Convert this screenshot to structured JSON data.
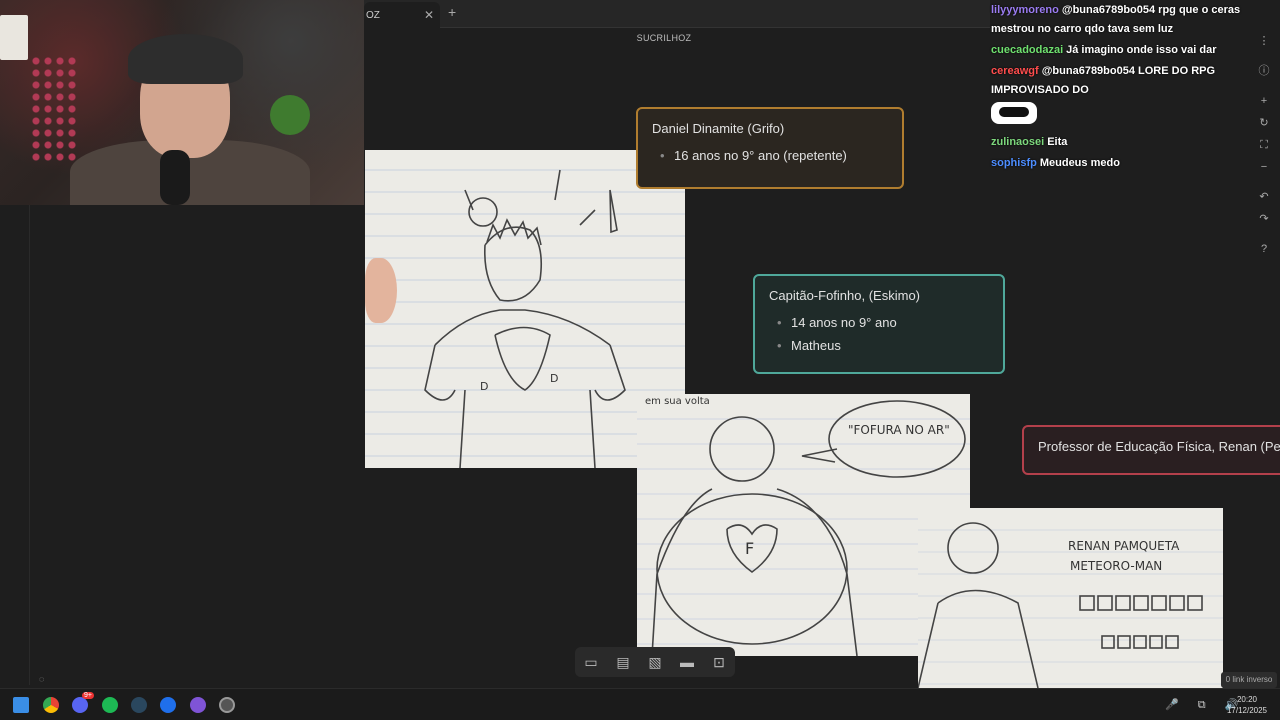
{
  "tabs": [
    {
      "label": "OZ",
      "close_symbol": "✕"
    }
  ],
  "new_tab_symbol": "+",
  "document_title": "SUCRILHOZ",
  "cards": {
    "daniel": {
      "title": "Daniel Dinamite (Grifo)",
      "items": [
        "16 anos no 9° ano (repetente)"
      ]
    },
    "capitao": {
      "title": "Capitão-Fofinho, (Eskimo)",
      "items": [
        "14 anos no 9° ano",
        "Matheus"
      ]
    },
    "renan": {
      "title": "Professor de Educação Física, Renan (Pesh"
    }
  },
  "sketch_text": {
    "speech_bubble": "\"FOFURA NO AR\"",
    "caption_top": "em sua volta",
    "renan_name": "RENAN PAMQUETA",
    "renan_hero": "METEORO-MAN",
    "heart_letter": "F",
    "chest_left": "D",
    "chest_right": "D"
  },
  "chat": [
    {
      "user": "lilyyymoreno",
      "color": "#9b7cf2",
      "text": "@buna6789bo054 rpg que o ceras mestrou no carro qdo tava sem luz"
    },
    {
      "user": "cuecadodazai",
      "color": "#6fe06f",
      "text": "Já imagino onde isso vai dar"
    },
    {
      "user": "cereawgf",
      "color": "#ff4d4d",
      "text": "@buna6789bo054 LORE DO RPG IMPROVISADO DO"
    },
    {
      "user": "zulinaosei",
      "color": "#7dd87d",
      "text": "Eita"
    },
    {
      "user": "sophisfp",
      "color": "#4d8dff",
      "text": "Meudeus medo"
    }
  ],
  "right_controls": [
    "⋮",
    "ⓘ",
    "+",
    "↻",
    "⛶",
    "−",
    "↶",
    "↷",
    "?"
  ],
  "toolbar_icons": [
    "new-note-icon",
    "text-file-icon",
    "image-icon",
    "card-icon",
    "frame-icon"
  ],
  "toolbar_glyphs": [
    "▭",
    "▤",
    "▧",
    "▬",
    "⊡"
  ],
  "link_inverse": "0 link inverso",
  "loading_glyph": "◌",
  "taskbar": {
    "time": "20:20",
    "date": "17/12/2025",
    "discord_badge": "9+",
    "tray": "🎤 ⧉ 🔊"
  }
}
